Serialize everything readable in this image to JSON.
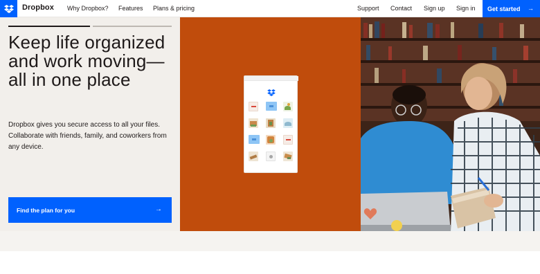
{
  "nav": {
    "brand": "Dropbox",
    "links": [
      "Why Dropbox?",
      "Features",
      "Plans & pricing"
    ],
    "right_links": [
      "Support",
      "Contact",
      "Sign up",
      "Sign in"
    ],
    "cta_label": "Get started",
    "cta_arrow": "→"
  },
  "hero": {
    "headline": "Keep life organized and work moving—all in one place",
    "subtext": "Dropbox gives you secure access to all your files. Collaborate with friends, family, and coworkers from any device.",
    "button_label": "Find the plan for you",
    "button_arrow": "→",
    "carousel_progress": 0.5
  },
  "colors": {
    "brand_blue": "#0061fe",
    "hero_bg": "#f2efeb",
    "orange_panel": "#c04c0c",
    "text": "#1e1919"
  },
  "icons": {
    "logo": "dropbox-logo-icon",
    "file_tiles": [
      "pdf-file-icon",
      "folder-icon",
      "image-file-icon",
      "pdf-file-icon",
      "image-file-icon",
      "image-file-icon",
      "image-file-icon",
      "folder-icon",
      "image-file-icon",
      "pdf-file-icon",
      "image-file-icon",
      "image-file-icon"
    ]
  }
}
